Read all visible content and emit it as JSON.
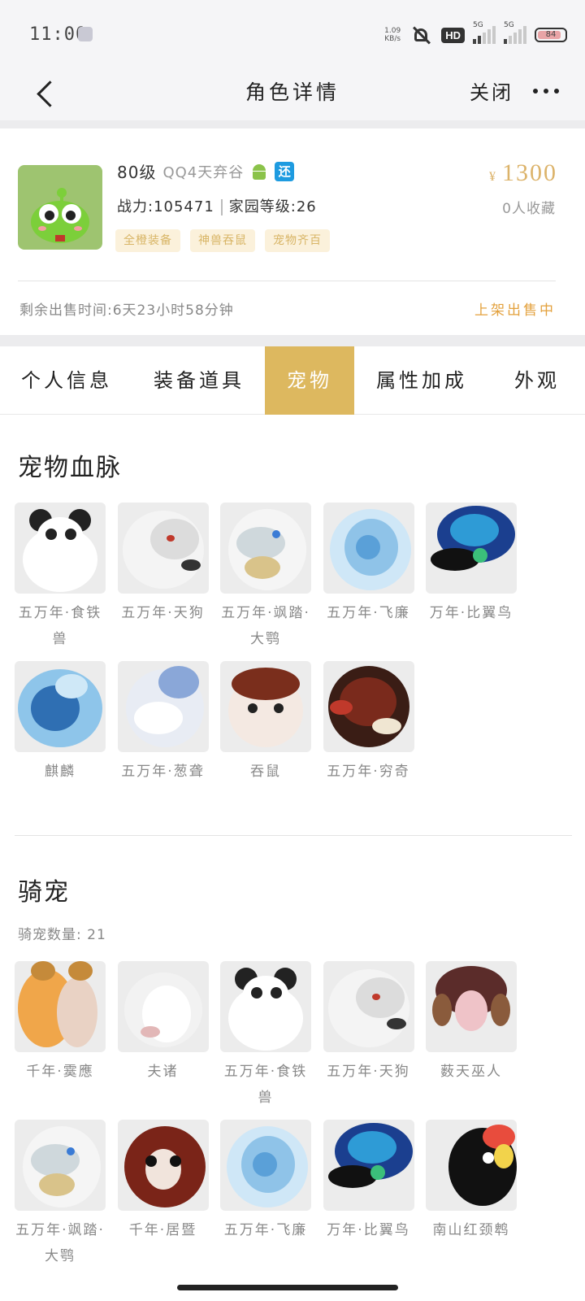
{
  "status_bar": {
    "time": "11:00",
    "net_speed_value": "1.09",
    "net_speed_unit": "KB/s",
    "hd_label": "HD",
    "signal1_label": "5G",
    "signal2_label": "5G",
    "battery_level": "84"
  },
  "nav": {
    "title": "角色详情",
    "close_label": "关闭"
  },
  "profile": {
    "level": "80级",
    "server": "QQ4天弃谷",
    "platform_icon": "android-icon",
    "badge": "还",
    "power_label": "战力:105471",
    "home_level_label": "家园等级:26",
    "tags": [
      "全橙装备",
      "神兽吞鼠",
      "宠物齐百"
    ],
    "price_symbol": "¥",
    "price": "1300",
    "favorites": "0人收藏",
    "remaining_time": "剩余出售时间:6天23小时58分钟",
    "sale_status": "上架出售中"
  },
  "tabs": [
    {
      "label": "个人信息",
      "active": false
    },
    {
      "label": "装备道具",
      "active": false
    },
    {
      "label": "宠物",
      "active": true
    },
    {
      "label": "属性加成",
      "active": false
    },
    {
      "label": "外观",
      "active": false
    }
  ],
  "pet_bloodline": {
    "title": "宠物血脉",
    "pets": [
      {
        "name": "五万年·食铁兽",
        "icon": "panda-icon"
      },
      {
        "name": "五万年·天狗",
        "icon": "white-wolf-icon"
      },
      {
        "name": "五万年·飒踏·大鹗",
        "icon": "eagle-icon"
      },
      {
        "name": "五万年·飞廉",
        "icon": "ice-dragon-icon"
      },
      {
        "name": "万年·比翼鸟",
        "icon": "blue-bird-icon"
      },
      {
        "name": "麒麟",
        "icon": "qilin-icon"
      },
      {
        "name": "五万年·葱聋",
        "icon": "white-horse-icon"
      },
      {
        "name": "吞鼠",
        "icon": "rodent-icon"
      },
      {
        "name": "五万年·穷奇",
        "icon": "beast-icon"
      }
    ]
  },
  "mounts": {
    "title": "骑宠",
    "count_label": "骑宠数量: 21",
    "items": [
      {
        "name": "千年·霙應",
        "icon": "horned-woman-icon"
      },
      {
        "name": "夫诸",
        "icon": "white-deer-icon"
      },
      {
        "name": "五万年·食铁兽",
        "icon": "panda-icon"
      },
      {
        "name": "五万年·天狗",
        "icon": "white-wolf-icon"
      },
      {
        "name": "薮天巫人",
        "icon": "masked-totem-icon"
      },
      {
        "name": "五万年·飒踏·大鹗",
        "icon": "eagle-icon"
      },
      {
        "name": "千年·居暨",
        "icon": "red-rodent-icon"
      },
      {
        "name": "五万年·飞廉",
        "icon": "ice-dragon-icon"
      },
      {
        "name": "万年·比翼鸟",
        "icon": "blue-bird-icon"
      },
      {
        "name": "南山红颈鹎",
        "icon": "toucan-icon"
      }
    ]
  },
  "colors": {
    "accent_gold": "#ddb85f",
    "price_gold": "#dcb36a",
    "sale_orange": "#e3a13d",
    "tag_bg": "#fbf1db",
    "badge_blue": "#1e9be0"
  }
}
